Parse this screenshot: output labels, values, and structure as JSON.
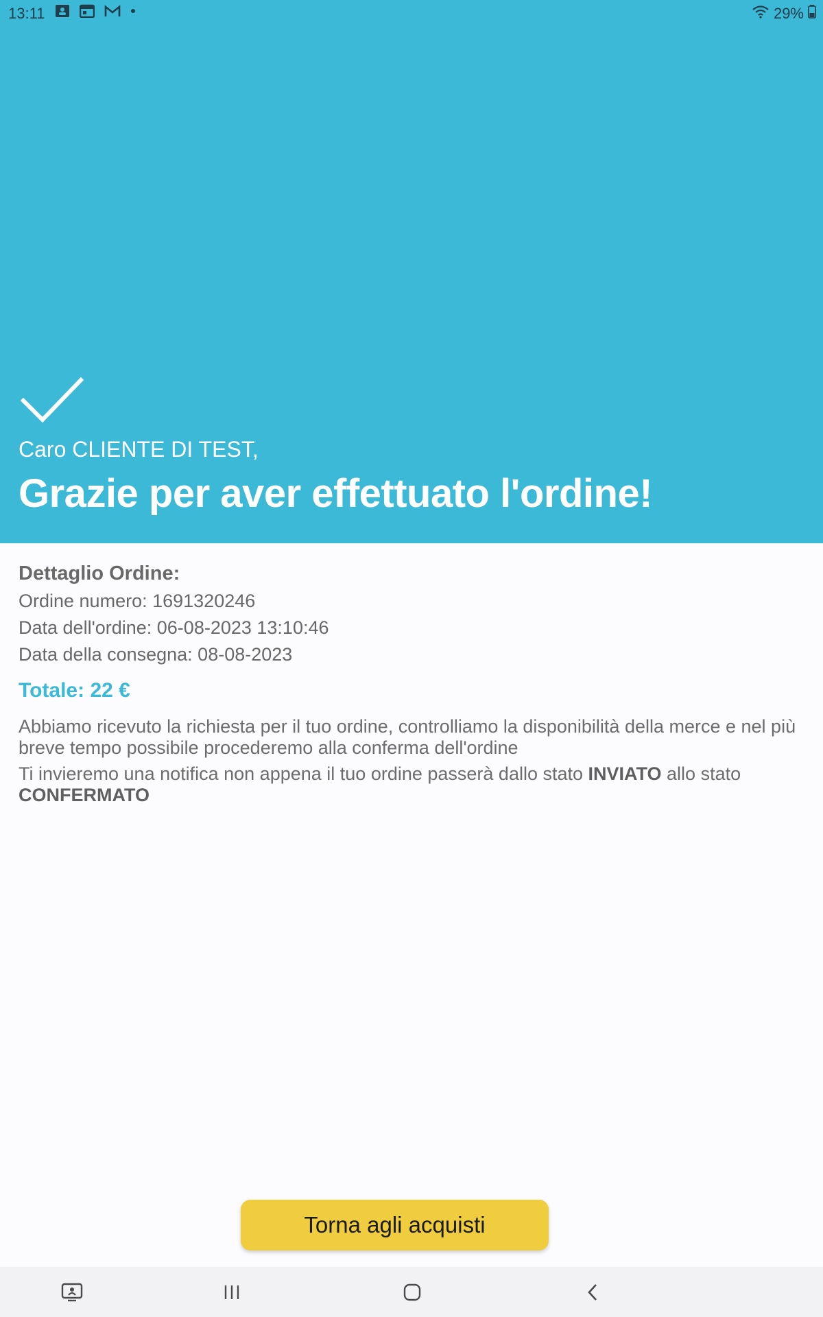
{
  "status_bar": {
    "time": "13:11",
    "battery": "29%",
    "icons": [
      "calendar-person-icon",
      "calendar-icon",
      "gmail-icon",
      "dot-icon",
      "wifi-icon",
      "battery-icon"
    ]
  },
  "header": {
    "greeting": "Caro CLIENTE DI TEST,",
    "title": "Grazie per aver effettuato l'ordine!",
    "check_icon": "checkmark-icon"
  },
  "order": {
    "section_title": "Dettaglio Ordine:",
    "number_line": "Ordine numero: 1691320246",
    "date_line": "Data dell'ordine: 06-08-2023 13:10:46",
    "delivery_line": "Data della consegna: 08-08-2023",
    "total_line": "Totale: 22 €"
  },
  "message": {
    "paragraph1": "Abbiamo ricevuto la richiesta per il tuo ordine, controlliamo la disponibilità della merce e nel più breve tempo possibile procederemo alla conferma dell'ordine",
    "paragraph2_prefix": "Ti invieremo una notifica non appena il tuo ordine passerà dallo stato ",
    "state_sent": "INVIATO",
    "paragraph2_middle": " allo stato ",
    "state_confirmed": "CONFERMATO"
  },
  "actions": {
    "back_to_shopping": "Torna agli acquisti"
  },
  "navbar": {
    "icons": [
      "screen-assist-icon",
      "recent-apps-icon",
      "home-icon",
      "back-icon"
    ]
  },
  "colors": {
    "primary": "#3bb9d6",
    "button": "#efcd3f",
    "text": "#686868"
  }
}
